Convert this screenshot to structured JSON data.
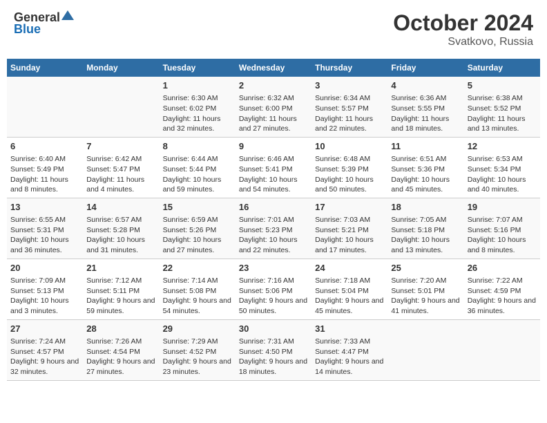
{
  "header": {
    "logo_general": "General",
    "logo_blue": "Blue",
    "title": "October 2024",
    "subtitle": "Svatkovo, Russia"
  },
  "days_of_week": [
    "Sunday",
    "Monday",
    "Tuesday",
    "Wednesday",
    "Thursday",
    "Friday",
    "Saturday"
  ],
  "weeks": [
    [
      {
        "day": "",
        "info": ""
      },
      {
        "day": "",
        "info": ""
      },
      {
        "day": "1",
        "info": "Sunrise: 6:30 AM\nSunset: 6:02 PM\nDaylight: 11 hours and 32 minutes."
      },
      {
        "day": "2",
        "info": "Sunrise: 6:32 AM\nSunset: 6:00 PM\nDaylight: 11 hours and 27 minutes."
      },
      {
        "day": "3",
        "info": "Sunrise: 6:34 AM\nSunset: 5:57 PM\nDaylight: 11 hours and 22 minutes."
      },
      {
        "day": "4",
        "info": "Sunrise: 6:36 AM\nSunset: 5:55 PM\nDaylight: 11 hours and 18 minutes."
      },
      {
        "day": "5",
        "info": "Sunrise: 6:38 AM\nSunset: 5:52 PM\nDaylight: 11 hours and 13 minutes."
      }
    ],
    [
      {
        "day": "6",
        "info": "Sunrise: 6:40 AM\nSunset: 5:49 PM\nDaylight: 11 hours and 8 minutes."
      },
      {
        "day": "7",
        "info": "Sunrise: 6:42 AM\nSunset: 5:47 PM\nDaylight: 11 hours and 4 minutes."
      },
      {
        "day": "8",
        "info": "Sunrise: 6:44 AM\nSunset: 5:44 PM\nDaylight: 10 hours and 59 minutes."
      },
      {
        "day": "9",
        "info": "Sunrise: 6:46 AM\nSunset: 5:41 PM\nDaylight: 10 hours and 54 minutes."
      },
      {
        "day": "10",
        "info": "Sunrise: 6:48 AM\nSunset: 5:39 PM\nDaylight: 10 hours and 50 minutes."
      },
      {
        "day": "11",
        "info": "Sunrise: 6:51 AM\nSunset: 5:36 PM\nDaylight: 10 hours and 45 minutes."
      },
      {
        "day": "12",
        "info": "Sunrise: 6:53 AM\nSunset: 5:34 PM\nDaylight: 10 hours and 40 minutes."
      }
    ],
    [
      {
        "day": "13",
        "info": "Sunrise: 6:55 AM\nSunset: 5:31 PM\nDaylight: 10 hours and 36 minutes."
      },
      {
        "day": "14",
        "info": "Sunrise: 6:57 AM\nSunset: 5:28 PM\nDaylight: 10 hours and 31 minutes."
      },
      {
        "day": "15",
        "info": "Sunrise: 6:59 AM\nSunset: 5:26 PM\nDaylight: 10 hours and 27 minutes."
      },
      {
        "day": "16",
        "info": "Sunrise: 7:01 AM\nSunset: 5:23 PM\nDaylight: 10 hours and 22 minutes."
      },
      {
        "day": "17",
        "info": "Sunrise: 7:03 AM\nSunset: 5:21 PM\nDaylight: 10 hours and 17 minutes."
      },
      {
        "day": "18",
        "info": "Sunrise: 7:05 AM\nSunset: 5:18 PM\nDaylight: 10 hours and 13 minutes."
      },
      {
        "day": "19",
        "info": "Sunrise: 7:07 AM\nSunset: 5:16 PM\nDaylight: 10 hours and 8 minutes."
      }
    ],
    [
      {
        "day": "20",
        "info": "Sunrise: 7:09 AM\nSunset: 5:13 PM\nDaylight: 10 hours and 3 minutes."
      },
      {
        "day": "21",
        "info": "Sunrise: 7:12 AM\nSunset: 5:11 PM\nDaylight: 9 hours and 59 minutes."
      },
      {
        "day": "22",
        "info": "Sunrise: 7:14 AM\nSunset: 5:08 PM\nDaylight: 9 hours and 54 minutes."
      },
      {
        "day": "23",
        "info": "Sunrise: 7:16 AM\nSunset: 5:06 PM\nDaylight: 9 hours and 50 minutes."
      },
      {
        "day": "24",
        "info": "Sunrise: 7:18 AM\nSunset: 5:04 PM\nDaylight: 9 hours and 45 minutes."
      },
      {
        "day": "25",
        "info": "Sunrise: 7:20 AM\nSunset: 5:01 PM\nDaylight: 9 hours and 41 minutes."
      },
      {
        "day": "26",
        "info": "Sunrise: 7:22 AM\nSunset: 4:59 PM\nDaylight: 9 hours and 36 minutes."
      }
    ],
    [
      {
        "day": "27",
        "info": "Sunrise: 7:24 AM\nSunset: 4:57 PM\nDaylight: 9 hours and 32 minutes."
      },
      {
        "day": "28",
        "info": "Sunrise: 7:26 AM\nSunset: 4:54 PM\nDaylight: 9 hours and 27 minutes."
      },
      {
        "day": "29",
        "info": "Sunrise: 7:29 AM\nSunset: 4:52 PM\nDaylight: 9 hours and 23 minutes."
      },
      {
        "day": "30",
        "info": "Sunrise: 7:31 AM\nSunset: 4:50 PM\nDaylight: 9 hours and 18 minutes."
      },
      {
        "day": "31",
        "info": "Sunrise: 7:33 AM\nSunset: 4:47 PM\nDaylight: 9 hours and 14 minutes."
      },
      {
        "day": "",
        "info": ""
      },
      {
        "day": "",
        "info": ""
      }
    ]
  ]
}
